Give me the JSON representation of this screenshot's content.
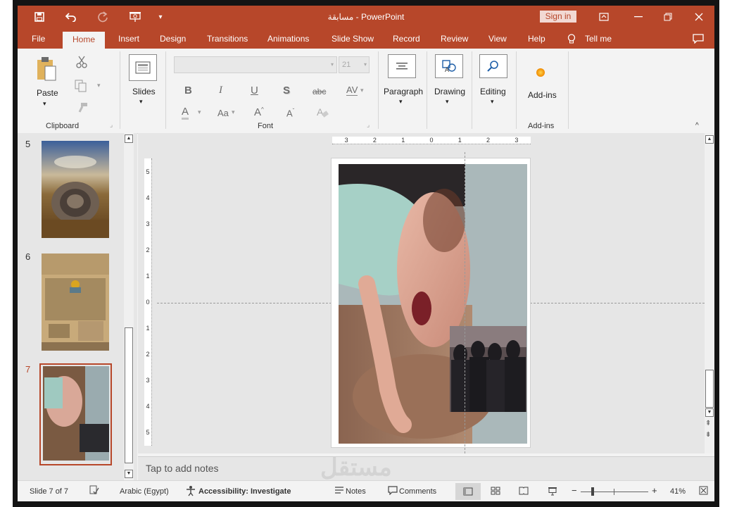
{
  "window": {
    "title": "مسابقة  -  PowerPoint",
    "sign_in_label": "Sign in"
  },
  "tabs": [
    "File",
    "Home",
    "Insert",
    "Design",
    "Transitions",
    "Animations",
    "Slide Show",
    "Record",
    "Review",
    "View",
    "Help"
  ],
  "tell_me": "Tell me",
  "ribbon": {
    "clipboard": {
      "paste_label": "Paste",
      "group_label": "Clipboard"
    },
    "slides": {
      "label": "Slides"
    },
    "font": {
      "font_name_value": "",
      "font_size_value": "21",
      "group_label": "Font",
      "bold": "B",
      "italic": "I",
      "underline": "U",
      "shadow": "S",
      "strike": "abc",
      "spacing": "AV",
      "font_color": "A",
      "case": "Aa",
      "grow": "A",
      "shrink": "A"
    },
    "paragraph": {
      "label": "Paragraph"
    },
    "drawing": {
      "label": "Drawing"
    },
    "editing": {
      "label": "Editing"
    },
    "addins": {
      "label": "Add-ins",
      "group_label": "Add-ins"
    }
  },
  "thumbnails": [
    {
      "number": "5"
    },
    {
      "number": "6"
    },
    {
      "number": "7",
      "selected": true
    }
  ],
  "ruler": {
    "horizontal": [
      "3",
      "2",
      "1",
      "0",
      "1",
      "2",
      "3"
    ],
    "vertical": [
      "5",
      "4",
      "3",
      "2",
      "1",
      "0",
      "1",
      "2",
      "3",
      "4",
      "5"
    ]
  },
  "notes_placeholder": "Tap to add notes",
  "watermark": "مستقل",
  "status": {
    "slide_info": "Slide 7 of 7",
    "language": "Arabic (Egypt)",
    "accessibility": "Accessibility: Investigate",
    "notes_label": "Notes",
    "comments_label": "Comments",
    "zoom_minus": "−",
    "zoom_plus": "+",
    "zoom_level": "41%",
    "zoom_fraction": 0.41
  },
  "colors": {
    "accent": "#b7472a",
    "ribbon_bg": "#f3f3f3",
    "workspace": "#e6e6e6"
  }
}
